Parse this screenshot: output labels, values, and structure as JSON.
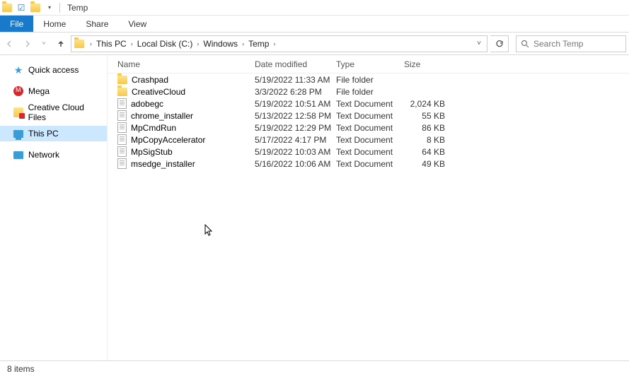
{
  "window": {
    "title": "Temp"
  },
  "ribbon": {
    "file": "File",
    "home": "Home",
    "share": "Share",
    "view": "View"
  },
  "breadcrumbs": [
    "This PC",
    "Local Disk (C:)",
    "Windows",
    "Temp"
  ],
  "search": {
    "placeholder": "Search Temp"
  },
  "sidebar": {
    "quick_access": "Quick access",
    "mega": "Mega",
    "creative_cloud": "Creative Cloud Files",
    "this_pc": "This PC",
    "network": "Network"
  },
  "columns": {
    "name": "Name",
    "date": "Date modified",
    "type": "Type",
    "size": "Size"
  },
  "items": [
    {
      "icon": "folder",
      "name": "Crashpad",
      "date": "5/19/2022 11:33 AM",
      "type": "File folder",
      "size": ""
    },
    {
      "icon": "folder",
      "name": "CreativeCloud",
      "date": "3/3/2022 6:28 PM",
      "type": "File folder",
      "size": ""
    },
    {
      "icon": "doc",
      "name": "adobegc",
      "date": "5/19/2022 10:51 AM",
      "type": "Text Document",
      "size": "2,024 KB"
    },
    {
      "icon": "doc",
      "name": "chrome_installer",
      "date": "5/13/2022 12:58 PM",
      "type": "Text Document",
      "size": "55 KB"
    },
    {
      "icon": "doc",
      "name": "MpCmdRun",
      "date": "5/19/2022 12:29 PM",
      "type": "Text Document",
      "size": "86 KB"
    },
    {
      "icon": "doc",
      "name": "MpCopyAccelerator",
      "date": "5/17/2022 4:17 PM",
      "type": "Text Document",
      "size": "8 KB"
    },
    {
      "icon": "doc",
      "name": "MpSigStub",
      "date": "5/19/2022 10:03 AM",
      "type": "Text Document",
      "size": "64 KB"
    },
    {
      "icon": "doc",
      "name": "msedge_installer",
      "date": "5/16/2022 10:06 AM",
      "type": "Text Document",
      "size": "49 KB"
    }
  ],
  "status": {
    "count": "8 items"
  }
}
